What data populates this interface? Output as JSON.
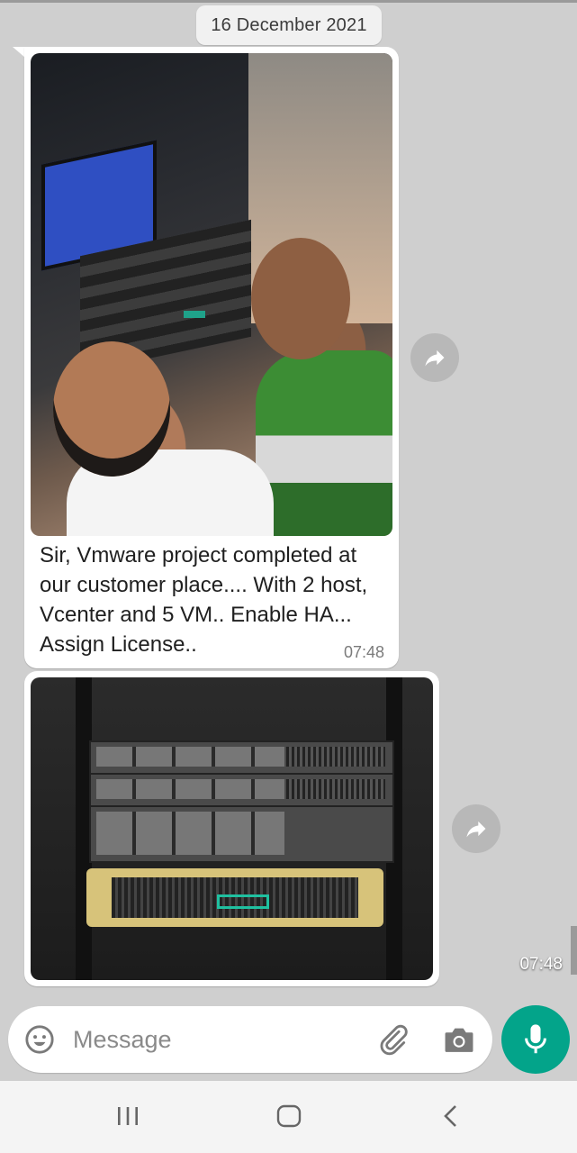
{
  "date_chip": "16 December 2021",
  "messages": [
    {
      "type": "image-with-caption",
      "caption": "Sir, Vmware project completed at our customer place.... With 2 host, Vcenter and 5 VM.. Enable HA... Assign License..",
      "time": "07:48",
      "image_label": "selfie of two men in front of a server rack"
    },
    {
      "type": "image",
      "time": "07:48",
      "image_label": "server rack with stacked servers and storage array"
    }
  ],
  "composer": {
    "placeholder": "Message",
    "icons": [
      "emoji-icon",
      "attachment-icon",
      "camera-icon"
    ]
  },
  "mic_icon": "microphone-icon",
  "forward_icon": "share-forward-icon",
  "navbar": {
    "icons": [
      "recents-icon",
      "home-icon",
      "back-icon"
    ]
  },
  "colors": {
    "chat_background": "#cfcfcf",
    "bubble": "#ffffff",
    "accent": "#03a48a"
  }
}
